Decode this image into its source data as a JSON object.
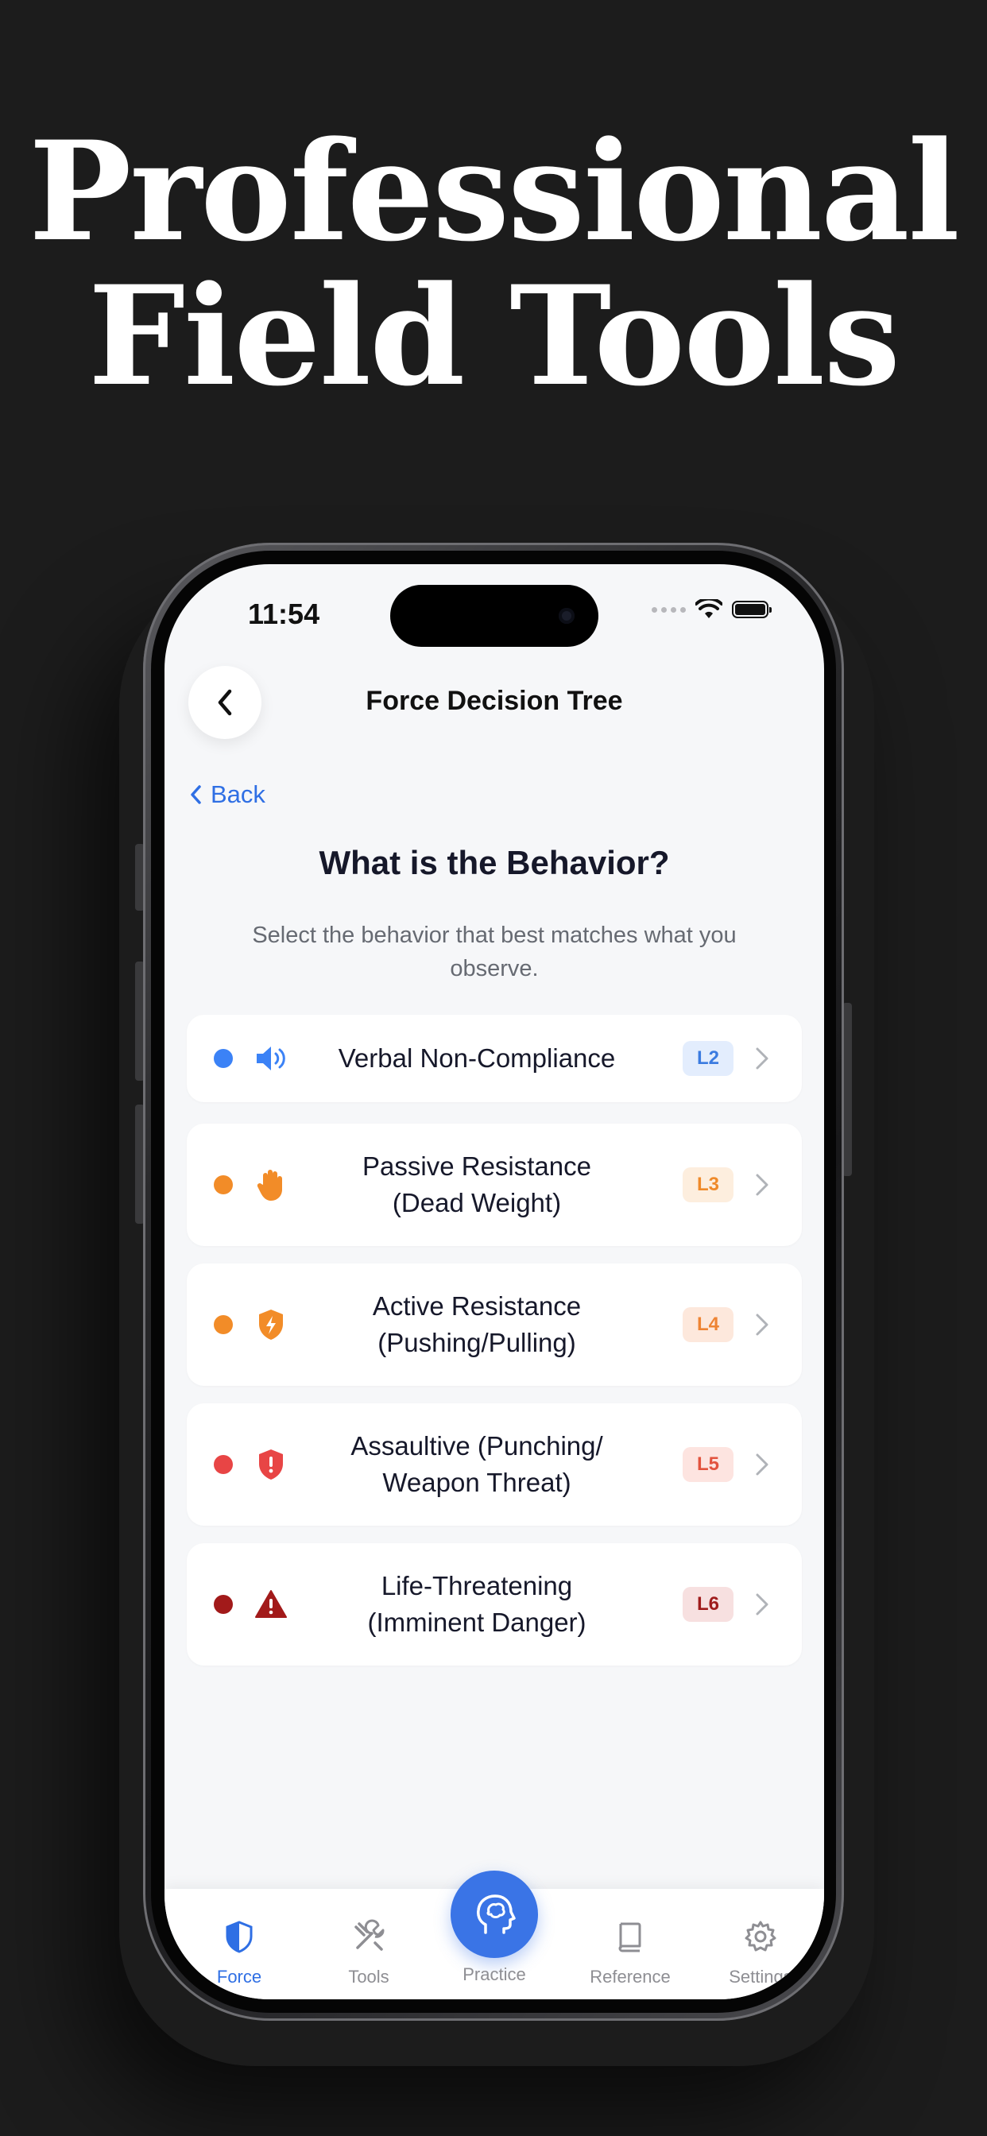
{
  "headline": [
    "Professional",
    "Field Tools"
  ],
  "status_bar": {
    "time": "11:54"
  },
  "nav": {
    "title": "Force Decision Tree",
    "back_label": "Back"
  },
  "question": "What is the Behavior?",
  "subtitle": "Select the behavior that best matches what you observe.",
  "behaviors": [
    {
      "label_lines": [
        "Verbal Non-Compliance"
      ],
      "badge": "L2",
      "icon": "speaker-icon",
      "dot_color": "#3b82f6",
      "badge_bg": "#e3edfd",
      "badge_color": "#3b7be0"
    },
    {
      "label_lines": [
        "Passive Resistance",
        "(Dead Weight)"
      ],
      "badge": "L3",
      "icon": "hand-icon",
      "dot_color": "#f28c28",
      "badge_bg": "#fdeede",
      "badge_color": "#ef8a2a"
    },
    {
      "label_lines": [
        "Active Resistance",
        "(Pushing/Pulling)"
      ],
      "badge": "L4",
      "icon": "bolt-shield-icon",
      "dot_color": "#f28c28",
      "badge_bg": "#fde8dc",
      "badge_color": "#ee8434"
    },
    {
      "label_lines": [
        "Assaultive (Punching/",
        "Weapon Threat)"
      ],
      "badge": "L5",
      "icon": "alert-shield-icon",
      "dot_color": "#e84545",
      "badge_bg": "#fde4e0",
      "badge_color": "#e2533e"
    },
    {
      "label_lines": [
        "Life-Threatening",
        "(Imminent Danger)"
      ],
      "badge": "L6",
      "icon": "warning-triangle-icon",
      "dot_color": "#a21a1a",
      "badge_bg": "#f7e0e0",
      "badge_color": "#9f1c1c"
    }
  ],
  "tabs": [
    {
      "label": "Force",
      "icon": "shield-icon",
      "active": true
    },
    {
      "label": "Tools",
      "icon": "tools-icon",
      "active": false
    },
    {
      "label": "Practice",
      "icon": "brain-head-icon",
      "active": false
    },
    {
      "label": "Reference",
      "icon": "book-icon",
      "active": false
    },
    {
      "label": "Settings",
      "icon": "gear-icon",
      "active": false
    }
  ],
  "colors": {
    "accent": "#2f6fe4",
    "background": "#1c1c1c",
    "screen_bg": "#f6f7f9"
  }
}
